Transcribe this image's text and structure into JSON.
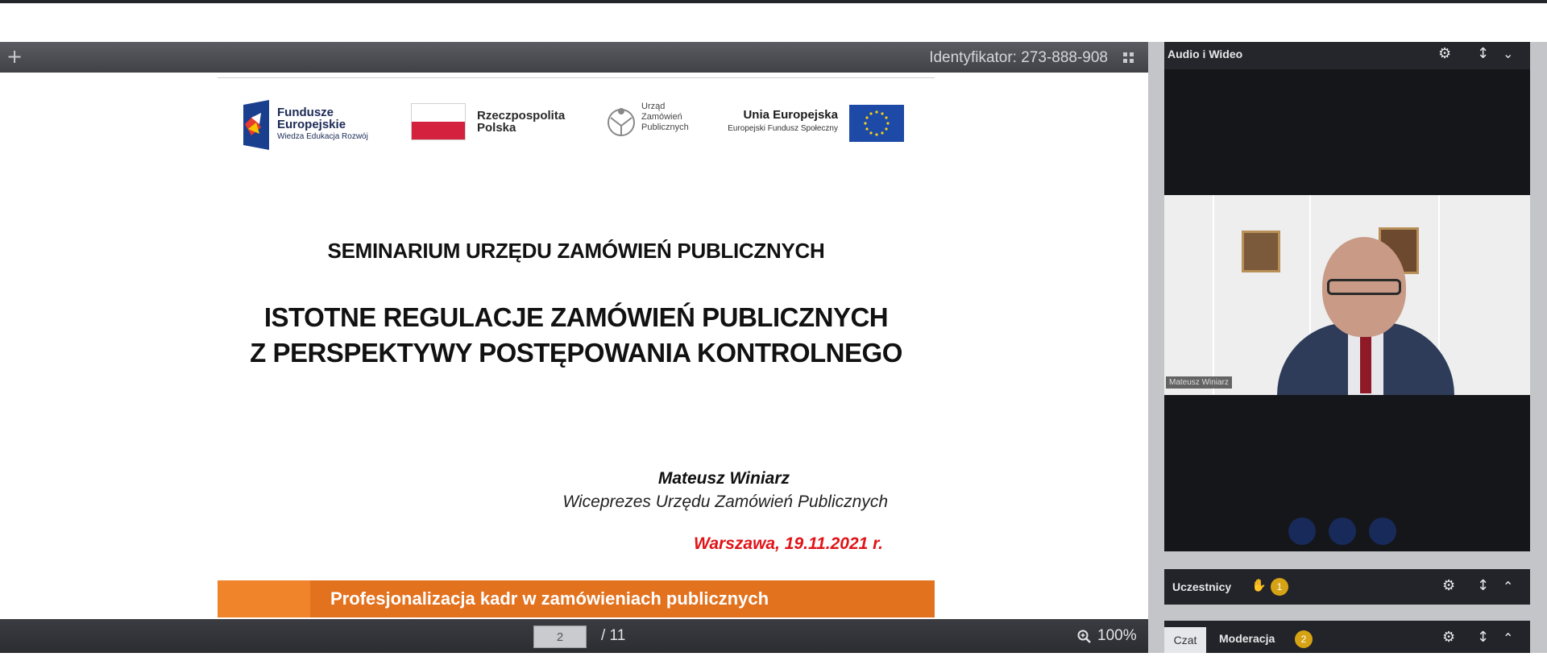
{
  "toolbar": {
    "add_label": "+",
    "meeting_id": "Identyfikator: 273-888-908"
  },
  "slide": {
    "logos": {
      "fe_line1": "Fundusze",
      "fe_line2": "Europejskie",
      "fe_sub": "Wiedza Edukacja Rozwój",
      "rp_line1": "Rzeczpospolita",
      "rp_line2": "Polska",
      "uzp_line1": "Urząd",
      "uzp_line2": "Zamówień",
      "uzp_line3": "Publicznych",
      "ue_title": "Unia Europejska",
      "ue_sub": "Europejski Fundusz Społeczny"
    },
    "seminar_title": "SEMINARIUM URZĘDU ZAMÓWIEŃ PUBLICZNYCH",
    "main_title_line1": "ISTOTNE REGULACJE ZAMÓWIEŃ PUBLICZNYCH",
    "main_title_line2": "Z PERSPEKTYWY POSTĘPOWANIA KONTROLNEGO",
    "speaker_name": "Mateusz Winiarz",
    "speaker_role": "Wiceprezes Urzędu Zamówień Publicznych",
    "place_date": "Warszawa, 19.11.2021 r.",
    "banner_text": "Profesjonalizacja kadr w zamówieniach publicznych"
  },
  "pager": {
    "current_page": "2",
    "total_pages": "/ 11",
    "zoom": "100%"
  },
  "video": {
    "title": "Audio i Wideo",
    "participant_name": "Mateusz Winiarz"
  },
  "participants": {
    "label": "Uczestnicy",
    "raised_hands": "1"
  },
  "chat": {
    "chat_tab": "Czat",
    "moderation_tab": "Moderacja",
    "moderation_count": "2"
  },
  "colors": {
    "banner_orange": "#e3721f",
    "date_red": "#e01418",
    "badge_yellow": "#d6a315",
    "panel_dark": "#15161a"
  }
}
